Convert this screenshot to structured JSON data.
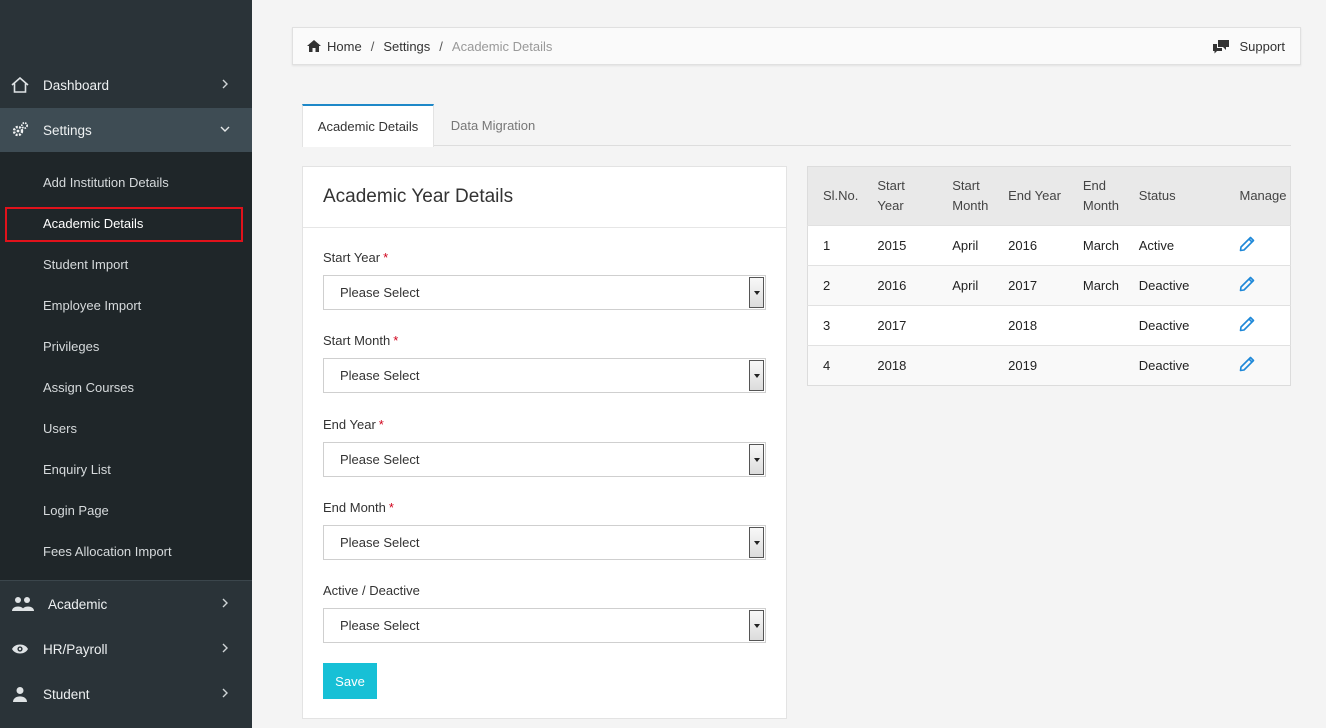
{
  "sidebar": {
    "nav": [
      {
        "label": "Dashboard",
        "icon": "home-icon"
      },
      {
        "label": "Settings",
        "icon": "gears-icon"
      },
      {
        "label": "Academic",
        "icon": "users-icon"
      },
      {
        "label": "HR/Payroll",
        "icon": "eye-icon"
      },
      {
        "label": "Student",
        "icon": "user-icon"
      }
    ],
    "settings_items": [
      "Add Institution Details",
      "Academic Details",
      "Student Import",
      "Employee Import",
      "Privileges",
      "Assign Courses",
      "Users",
      "Enquiry List",
      "Login Page",
      "Fees Allocation Import"
    ]
  },
  "breadcrumb": {
    "home": "Home",
    "settings": "Settings",
    "current": "Academic Details",
    "separator": "/",
    "support": "Support"
  },
  "tabs": [
    "Academic Details",
    "Data Migration"
  ],
  "form": {
    "title": "Academic Year Details",
    "required_mark": "*",
    "fields": [
      {
        "label": "Start Year",
        "required": true,
        "value": "Please Select"
      },
      {
        "label": "Start Month",
        "required": true,
        "value": "Please Select"
      },
      {
        "label": "End Year",
        "required": true,
        "value": "Please Select"
      },
      {
        "label": "End Month",
        "required": true,
        "value": "Please Select"
      },
      {
        "label": "Active / Deactive",
        "required": false,
        "value": "Please Select"
      }
    ],
    "save_label": "Save"
  },
  "table": {
    "headers": {
      "slno": "Sl.No.",
      "start_year": "Start Year",
      "start_month": "Start Month",
      "end_year": "End Year",
      "end_month": "End Month",
      "status": "Status",
      "manage": "Manage"
    },
    "rows": [
      {
        "slno": "1",
        "start_year": "2015",
        "start_month": "April",
        "end_year": "2016",
        "end_month": "March",
        "status": "Active"
      },
      {
        "slno": "2",
        "start_year": "2016",
        "start_month": "April",
        "end_year": "2017",
        "end_month": "March",
        "status": "Deactive"
      },
      {
        "slno": "3",
        "start_year": "2017",
        "start_month": "",
        "end_year": "2018",
        "end_month": "",
        "status": "Deactive"
      },
      {
        "slno": "4",
        "start_year": "2018",
        "start_month": "",
        "end_year": "2019",
        "end_month": "",
        "status": "Deactive"
      }
    ]
  },
  "colors": {
    "sidebar_bg": "#2a3338",
    "accent": "#1e88c8",
    "save_button": "#17c0d6",
    "highlight": "#e0121b"
  }
}
